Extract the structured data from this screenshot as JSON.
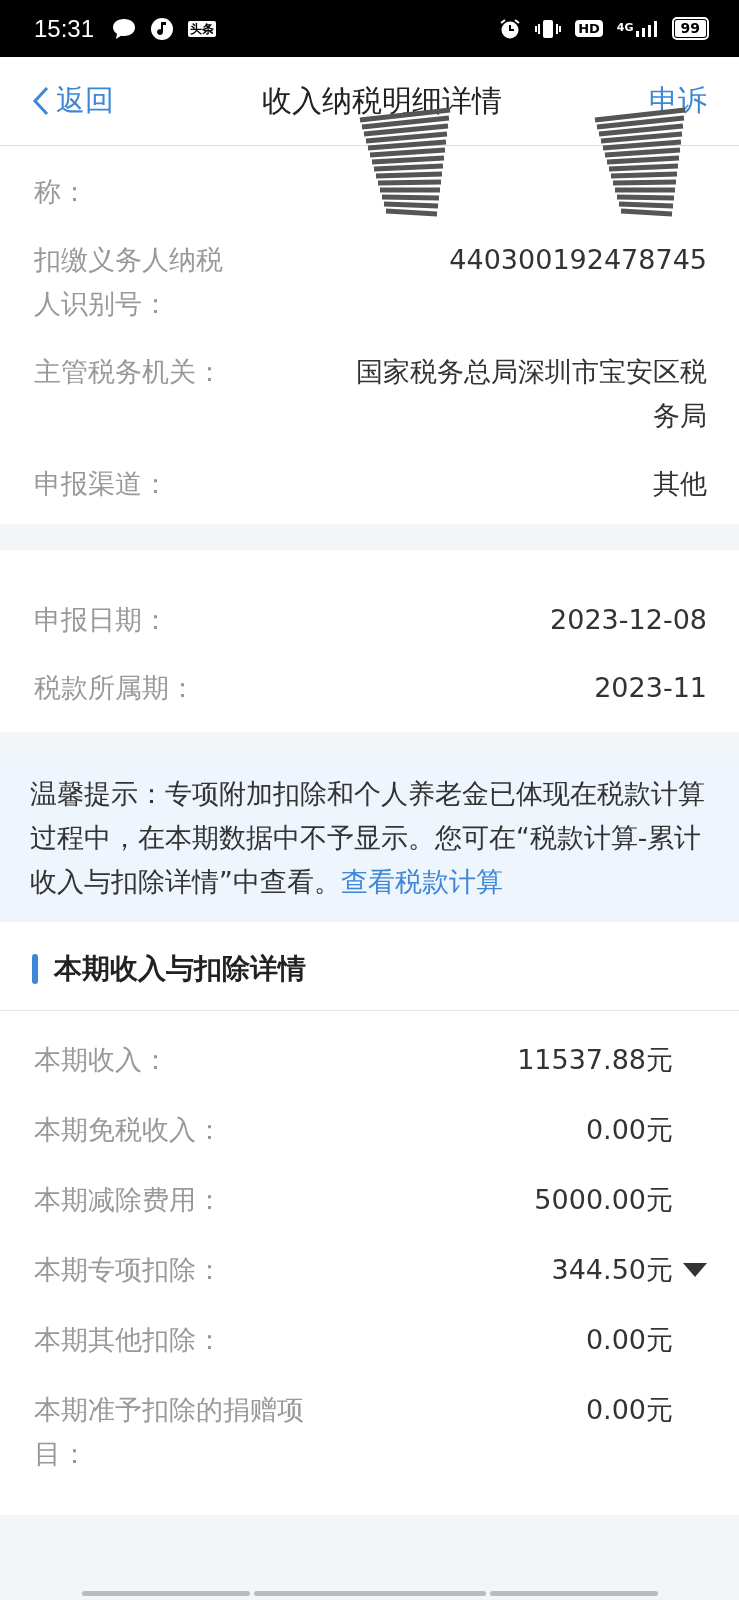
{
  "status_bar": {
    "time": "15:31",
    "app_badge": "头条",
    "hd_badge": "HD",
    "network": "4G",
    "battery": "99"
  },
  "header": {
    "back": "返回",
    "title": "收入纳税明细详情",
    "action": "申诉"
  },
  "payer_section": {
    "rows": [
      {
        "label": "称：",
        "kind": "redacted"
      },
      {
        "label": "扣缴义务人纳税人识别号：",
        "value": "440300192478745",
        "kind": "plain"
      },
      {
        "label": "主管税务机关：",
        "value": "国家税务总局深圳市宝安区税务局",
        "kind": "plain"
      },
      {
        "label": "申报渠道：",
        "value": "其他",
        "kind": "plain"
      }
    ]
  },
  "date_section": {
    "rows": [
      {
        "label": "申报日期：",
        "value": "2023-12-08",
        "kind": "plain"
      },
      {
        "label": "税款所属期：",
        "value": "2023-11",
        "kind": "plain"
      }
    ]
  },
  "tip": {
    "text": "温馨提示：专项附加扣除和个人养老金已体现在税款计算过程中，在本期数据中不予显示。您可在“税款计算-累计收入与扣除详情”中查看。",
    "link": "查看税款计算"
  },
  "income_section": {
    "title": "本期收入与扣除详情",
    "rows": [
      {
        "label": "本期收入：",
        "value": "11537.88元",
        "kind": "plain"
      },
      {
        "label": "本期免税收入：",
        "value": "0.00元",
        "kind": "plain"
      },
      {
        "label": "本期减除费用：",
        "value": "5000.00元",
        "kind": "plain"
      },
      {
        "label": "本期专项扣除：",
        "value": "344.50元",
        "kind": "expandable"
      },
      {
        "label": "本期其他扣除：",
        "value": "0.00元",
        "kind": "plain"
      },
      {
        "label": "本期准予扣除的捐赠项目：",
        "value": "0.00元",
        "kind": "plain"
      }
    ]
  }
}
